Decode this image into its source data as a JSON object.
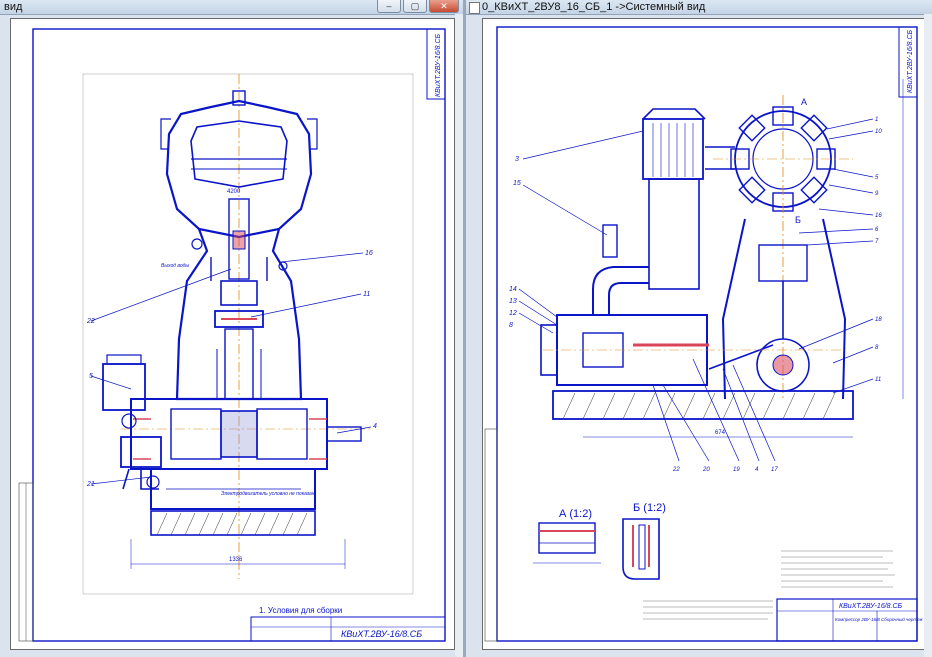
{
  "windows": [
    {
      "id": "left",
      "title": "вид",
      "controls": [
        "–",
        "▢",
        "✕"
      ],
      "drawing": {
        "stamp": "КВиХТ.2ВУ-16/8.СБ",
        "sheet_label": "1. Условия для сборки",
        "dimension_width": "1336",
        "dimension_top": "4200",
        "inlet_label": "Выход воды",
        "callouts": [
          "16",
          "11",
          "22",
          "5",
          "4",
          "21"
        ],
        "note": "Электродвигатель условно не показан"
      }
    },
    {
      "id": "right",
      "title": "0_КВиХТ_2ВУ8_16_СБ_1 ->Системный вид",
      "controls": [
        "–",
        "▢",
        "✕"
      ],
      "drawing": {
        "stamp": "КВиХТ.2ВУ-16/8.СБ",
        "stamp_subtitle": "Компрессор 2ВУ-16/8 Сборочный чертеж",
        "view_a": "А (1:2)",
        "view_b": "Б (1:2)",
        "letter_a": "А",
        "letter_b": "Б",
        "callouts_left": [
          "3",
          "15",
          "14",
          "13",
          "12",
          "8"
        ],
        "callouts_right": [
          "1",
          "10",
          "5",
          "9",
          "16",
          "6",
          "7",
          "18",
          "8",
          "11"
        ],
        "callouts_bottom": [
          "22",
          "20",
          "19",
          "4",
          "17"
        ],
        "dimension_bottom": "674"
      }
    }
  ]
}
